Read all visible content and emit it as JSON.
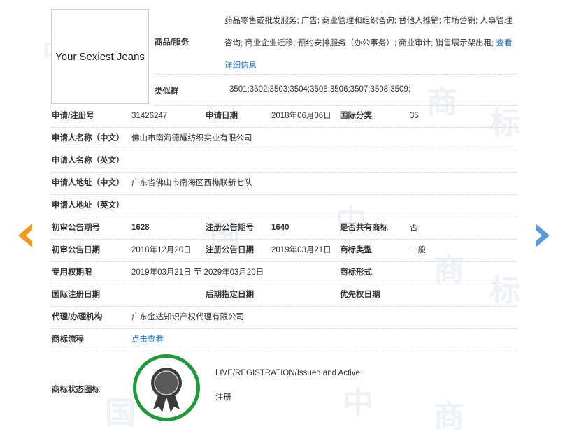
{
  "brand": {
    "logo_text": "Your Sexiest Jeans"
  },
  "services": {
    "label": "商品/服务",
    "text": "药品零售或批发服务; 广告; 商业管理和组织咨询; 替他人推销; 市场营销; 人事管理咨询; 商业企业迁移; 预约安排服务（办公事务）; 商业审计; 销售展示架出租;",
    "detail_link": "查看详细信息"
  },
  "similar_group": {
    "label": "类似群",
    "value": "3501;3502;3503;3504;3505;3506;3507;3508;3509;"
  },
  "reg": {
    "no_label": "申请/注册号",
    "no": "31426247",
    "date_label": "申请日期",
    "date": "2018年06月06日",
    "class_label": "国际分类",
    "class": "35"
  },
  "applicant": {
    "name_cn_label": "申请人名称（中文）",
    "name_cn": "佛山市南海德耀纺织实业有限公司",
    "name_en_label": "申请人名称（英文）",
    "name_en": "",
    "addr_cn_label": "申请人地址（中文）",
    "addr_cn": "广东省佛山市南海区西樵联新七队",
    "addr_en_label": "申请人地址（英文）",
    "addr_en": ""
  },
  "publication": {
    "prelim_no_label": "初审公告期号",
    "prelim_no": "1628",
    "reg_no_label": "注册公告期号",
    "reg_no": "1640",
    "shared_label": "是否共有商标",
    "shared": "否",
    "prelim_date_label": "初审公告日期",
    "prelim_date": "2018年12月20日",
    "reg_date_label": "注册公告日期",
    "reg_date": "2019年03月21日",
    "type_label": "商标类型",
    "type": "一般"
  },
  "rights": {
    "period_label": "专用权期限",
    "period": "2019年03月21日 至 2029年03月20日",
    "form_label": "商标形式",
    "form": "",
    "intl_date_label": "国际注册日期",
    "intl_date": "",
    "later_date_label": "后期指定日期",
    "later_date": "",
    "priority_label": "优先权日期",
    "priority": ""
  },
  "agent": {
    "label": "代理/办理机构",
    "value": "广东金达知识产权代理有限公司"
  },
  "flow": {
    "label": "商标流程",
    "link": "点击查看"
  },
  "status": {
    "label": "商标状态图标",
    "status_en": "LIVE/REGISTRATION/Issued and Active",
    "status_cn": "注册"
  },
  "watermark": {
    "chars": [
      "中",
      "国",
      "商",
      "标"
    ]
  },
  "colors": {
    "link": "#1a73c8",
    "prev_arrow": "#f39a1e",
    "next_arrow": "#5b9bd5",
    "badge_ring": "#1e9a3a"
  }
}
